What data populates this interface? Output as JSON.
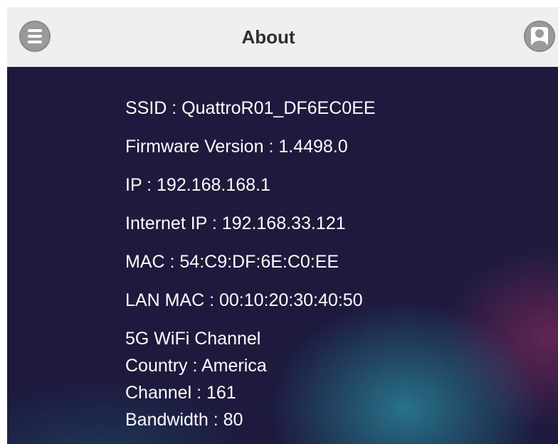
{
  "header": {
    "title": "About",
    "menu_icon": "menu-icon",
    "user_icon": "user-icon"
  },
  "info": {
    "ssid": "SSID : QuattroR01_DF6EC0EE",
    "firmware": "Firmware Version : 1.4498.0",
    "ip": "IP : 192.168.168.1",
    "internet_ip": "Internet IP : 192.168.33.121",
    "mac": "MAC : 54:C9:DF:6E:C0:EE",
    "lan_mac": "LAN MAC : 00:10:20:30:40:50",
    "wifi_heading": "5G WiFi Channel",
    "country": "Country : America",
    "channel": "Channel : 161",
    "bandwidth": "Bandwidth : 80"
  },
  "colors": {
    "header_bg": "#efefef",
    "content_bg": "#1d1a3e",
    "text": "#ffffff"
  }
}
